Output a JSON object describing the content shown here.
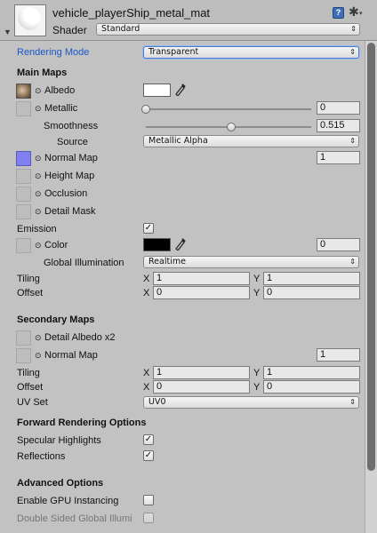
{
  "header": {
    "material_name": "vehicle_playerShip_metal_mat",
    "shader_label": "Shader",
    "shader_value": "Standard",
    "fold_arrow": "▼",
    "help_icon": "book-icon",
    "settings_icon": "gear-icon"
  },
  "rendering_mode": {
    "label": "Rendering Mode",
    "value": "Transparent"
  },
  "main_maps": {
    "title": "Main Maps",
    "albedo": {
      "label": "Albedo",
      "color": "#ffffff"
    },
    "metallic": {
      "label": "Metallic",
      "value": "0",
      "slider_fraction": 0.0
    },
    "smoothness": {
      "label": "Smoothness",
      "value": "0.515",
      "slider_fraction": 0.515
    },
    "source": {
      "label": "Source",
      "value": "Metallic Alpha"
    },
    "normal_map": {
      "label": "Normal Map",
      "value": "1"
    },
    "height_map": {
      "label": "Height Map"
    },
    "occlusion": {
      "label": "Occlusion"
    },
    "detail_mask": {
      "label": "Detail Mask"
    },
    "emission": {
      "label": "Emission",
      "checked": true
    },
    "emission_color": {
      "label": "Color",
      "color": "#000000",
      "value": "0"
    },
    "global_illumination": {
      "label": "Global Illumination",
      "value": "Realtime"
    },
    "tiling": {
      "label": "Tiling",
      "x_label": "X",
      "x": "1",
      "y_label": "Y",
      "y": "1"
    },
    "offset": {
      "label": "Offset",
      "x_label": "X",
      "x": "0",
      "y_label": "Y",
      "y": "0"
    }
  },
  "secondary_maps": {
    "title": "Secondary Maps",
    "detail_albedo": {
      "label": "Detail Albedo x2"
    },
    "normal_map": {
      "label": "Normal Map",
      "value": "1"
    },
    "tiling": {
      "label": "Tiling",
      "x_label": "X",
      "x": "1",
      "y_label": "Y",
      "y": "1"
    },
    "offset": {
      "label": "Offset",
      "x_label": "X",
      "x": "0",
      "y_label": "Y",
      "y": "0"
    },
    "uv_set": {
      "label": "UV Set",
      "value": "UV0"
    }
  },
  "forward_rendering": {
    "title": "Forward Rendering Options",
    "specular_highlights": {
      "label": "Specular Highlights",
      "checked": true
    },
    "reflections": {
      "label": "Reflections",
      "checked": true
    }
  },
  "advanced": {
    "title": "Advanced Options",
    "gpu_instancing": {
      "label": "Enable GPU Instancing",
      "checked": false
    },
    "double_sided_gi": {
      "label": "Double Sided Global Illumi",
      "checked": false
    }
  },
  "glyphs": {
    "dot": "⊙",
    "check": "✓",
    "arrows": "⇕",
    "picker": "⁄",
    "book": "?",
    "gear": "✱",
    "caret": "▾"
  }
}
